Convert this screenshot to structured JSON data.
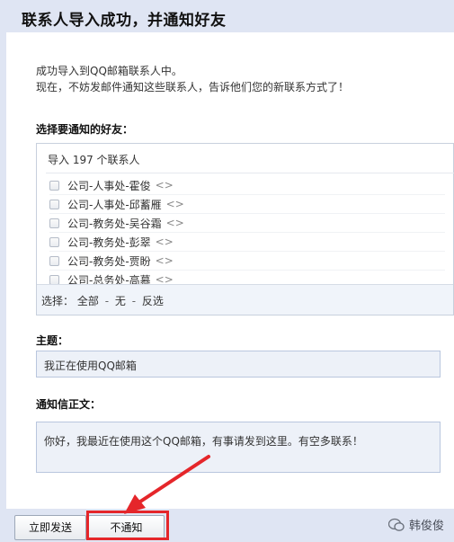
{
  "header": {
    "title": "联系人导入成功，并通知好友"
  },
  "intro": {
    "line1": "成功导入到QQ邮箱联系人中。",
    "line2": "现在，不妨发邮件通知这些联系人，告诉他们您的新联系方式了！"
  },
  "contacts": {
    "label": "选择要通知的好友：",
    "summary": "导入 197 个联系人",
    "items": [
      {
        "name": "公司-人事处-霍俊",
        "email": "<>"
      },
      {
        "name": "公司-人事处-邱蓄雁",
        "email": "<>"
      },
      {
        "name": "公司-教务处-吴谷霜",
        "email": "<>"
      },
      {
        "name": "公司-教务处-彭翠",
        "email": "<>"
      },
      {
        "name": "公司-教务处-贾盼",
        "email": "<>"
      },
      {
        "name": "公司-总务处-高慕",
        "email": "<>"
      }
    ],
    "select_prefix": "选择：",
    "select_all": "全部",
    "select_none": "无",
    "select_invert": "反选",
    "separator": "-"
  },
  "subject": {
    "label": "主题：",
    "value": "我正在使用QQ邮箱"
  },
  "body": {
    "label": "通知信正文：",
    "value": "你好，我最近在使用这个QQ邮箱，有事请发到这里。有空多联系！"
  },
  "buttons": {
    "send": "立即发送",
    "skip": "不通知"
  },
  "watermark": {
    "text": "韩俊俊"
  },
  "colors": {
    "highlight": "#e5262a",
    "background": "#dfe5f3"
  }
}
